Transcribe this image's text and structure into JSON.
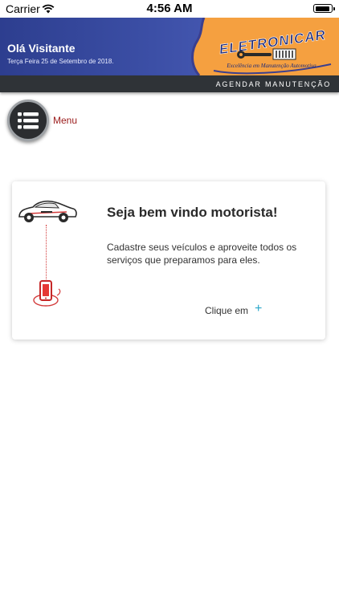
{
  "status_bar": {
    "carrier": "Carrier",
    "time": "4:56 AM"
  },
  "header": {
    "greeting": "Olá Visitante",
    "date": "Terça Feira 25 de Setembro de 2018.",
    "logo": {
      "brand": "ELETRONICAR",
      "tagline": "Excelência em Manutenção Automotiva"
    }
  },
  "nav": {
    "schedule_label": "AGENDAR MANUTENÇÃO"
  },
  "menu": {
    "label": "Menu"
  },
  "card": {
    "title": "Seja bem vindo motorista!",
    "text": "Cadastre seus veículos e aproveite todos os serviços que preparamos para eles.",
    "cta_label": "Clique em",
    "cta_icon": "+"
  },
  "colors": {
    "header_blue": "#3c4fa6",
    "logo_orange": "#f5a040",
    "menu_red": "#9a1a1a",
    "accent_teal": "#2aa7c9"
  }
}
